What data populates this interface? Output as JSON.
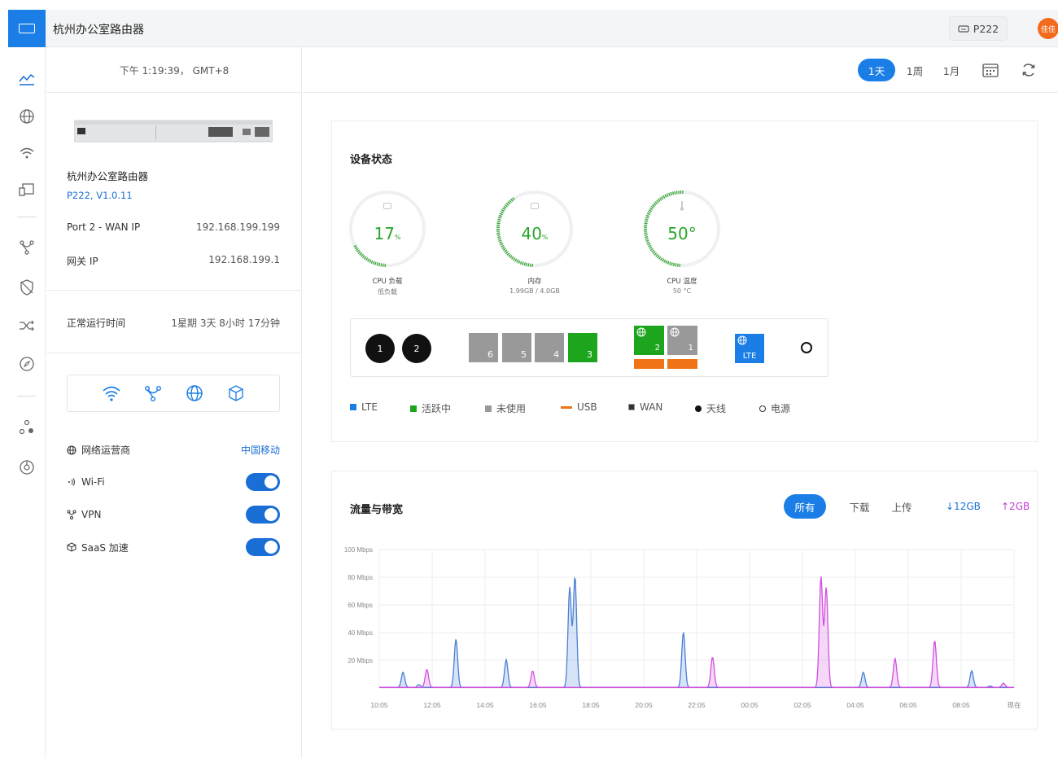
{
  "header": {
    "title": "杭州办公室路由器",
    "device_chip": "P222",
    "avatar_text": "佳佳"
  },
  "nav": {
    "items": [
      "chart-icon",
      "globe-icon",
      "wifi-icon",
      "devices-icon",
      "vpn-icon",
      "shield-icon",
      "shuffle-icon",
      "compass-icon",
      "topology-icon",
      "settings-icon"
    ]
  },
  "side": {
    "clock": "下午 1:19:39， GMT+8",
    "device_name": "杭州办公室路由器",
    "device_model": "P222, V1.0.11",
    "wan_ip_label": "Port 2 - WAN IP",
    "wan_ip_value": "192.168.199.199",
    "gateway_label": "网关 IP",
    "gateway_value": "192.168.199.1",
    "uptime_label": "正常运行时间",
    "uptime_value": "1星期 3天 8小时 17分钟",
    "operator_label": "网络运营商",
    "operator_value": "中国移动",
    "wifi_label": "Wi-Fi",
    "vpn_label": "VPN",
    "saas_label": "SaaS 加速"
  },
  "range": {
    "options": [
      "1天",
      "1周",
      "1月"
    ],
    "selected": "1天"
  },
  "status": {
    "title": "设备状态",
    "cpu": {
      "value": "17",
      "unit": "%",
      "label": "CPU 负载",
      "sub": "低负载",
      "percent": 17
    },
    "mem": {
      "value": "40",
      "unit": "%",
      "label": "内存",
      "sub": "1.99GB / 4.0GB",
      "percent": 40
    },
    "temp": {
      "value": "50°",
      "unit": "",
      "label": "CPU 温度",
      "sub": "50 °C",
      "percent": 50
    },
    "antennas": [
      "1",
      "2"
    ],
    "ports": [
      "6",
      "5",
      "4",
      "3"
    ],
    "wan_ports": [
      "2",
      "1"
    ],
    "lte_label": "LTE",
    "legend": [
      "LTE",
      "活跃中",
      "未使用",
      "USB",
      "WAN",
      "天线",
      "电源"
    ],
    "colors": {
      "lte": "#1a7ee6",
      "active": "#1ea51e",
      "unused": "#999999",
      "usb": "#f07315"
    }
  },
  "traffic": {
    "title": "流量与带宽",
    "filters": [
      "所有",
      "下载",
      "上传"
    ],
    "selected": "所有",
    "download_total": "↓12GB",
    "upload_total": "↑2GB"
  },
  "chart_data": {
    "type": "area",
    "y_ticks": [
      "100 Mbps",
      "80 Mbps",
      "60 Mbps",
      "40 Mbps",
      "20 Mbps"
    ],
    "x_ticks": [
      "10:05",
      "12:05",
      "14:05",
      "16:05",
      "18:05",
      "20:05",
      "22:05",
      "00:05",
      "02:05",
      "04:05",
      "06:05",
      "08:05",
      "现在"
    ],
    "ylim": [
      0,
      100
    ],
    "series": [
      {
        "color": "#4a7fd4",
        "peaks": [
          [
            0.9,
            11
          ],
          [
            1.5,
            2
          ],
          [
            2.9,
            35
          ],
          [
            4.8,
            20
          ],
          [
            7.2,
            72
          ],
          [
            7.4,
            80
          ],
          [
            11.5,
            40
          ],
          [
            18.3,
            11
          ],
          [
            22.4,
            12
          ],
          [
            23.1,
            1
          ]
        ]
      },
      {
        "color": "#d24fe0",
        "peaks": [
          [
            1.8,
            13
          ],
          [
            5.8,
            12
          ],
          [
            12.6,
            22
          ],
          [
            16.7,
            80
          ],
          [
            16.9,
            72
          ],
          [
            19.5,
            21
          ],
          [
            21.0,
            34
          ],
          [
            23.6,
            3
          ],
          [
            24.2,
            12
          ]
        ]
      }
    ]
  }
}
